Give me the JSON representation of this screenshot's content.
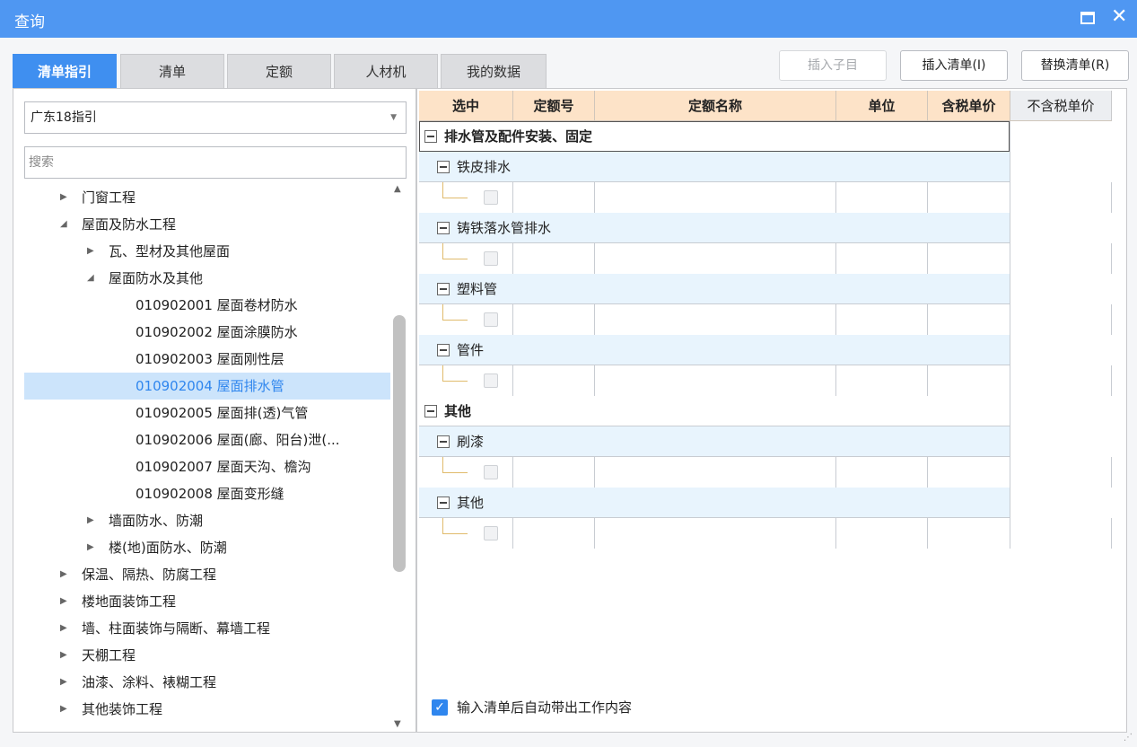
{
  "window": {
    "title": "查询",
    "maximize_icon": "square-icon",
    "close_label": "✕"
  },
  "tabs": [
    {
      "label": "清单指引",
      "active": true
    },
    {
      "label": "清单",
      "active": false
    },
    {
      "label": "定额",
      "active": false
    },
    {
      "label": "人材机",
      "active": false
    },
    {
      "label": "我的数据",
      "active": false
    }
  ],
  "toolbar": {
    "insert_child_label": "插入子目",
    "insert_list_label": "插入清单(I)",
    "replace_list_label": "替换清单(R)"
  },
  "left": {
    "selector_value": "广东18指引",
    "search_placeholder": "搜索",
    "tree": [
      {
        "label": "门窗工程",
        "expanded": false
      },
      {
        "label": "屋面及防水工程",
        "expanded": true
      },
      {
        "label": "瓦、型材及其他屋面",
        "expanded": false
      },
      {
        "label": "屋面防水及其他",
        "expanded": true
      },
      {
        "label": "010902001  屋面卷材防水"
      },
      {
        "label": "010902002  屋面涂膜防水"
      },
      {
        "label": "010902003  屋面刚性层"
      },
      {
        "label": "010902004  屋面排水管",
        "selected": true
      },
      {
        "label": "010902005  屋面排(透)气管"
      },
      {
        "label": "010902006  屋面(廊、阳台)泄(..."
      },
      {
        "label": "010902007  屋面天沟、檐沟"
      },
      {
        "label": "010902008  屋面变形缝"
      },
      {
        "label": "墙面防水、防潮",
        "expanded": false
      },
      {
        "label": "楼(地)面防水、防潮",
        "expanded": false
      },
      {
        "label": "保温、隔热、防腐工程",
        "expanded": false
      },
      {
        "label": "楼地面装饰工程",
        "expanded": false
      },
      {
        "label": "墙、柱面装饰与隔断、幕墙工程",
        "expanded": false
      },
      {
        "label": "天棚工程",
        "expanded": false
      },
      {
        "label": "油漆、涂料、裱糊工程",
        "expanded": false
      },
      {
        "label": "其他装饰工程",
        "expanded": false
      }
    ]
  },
  "grid": {
    "columns": [
      "选中",
      "定额号",
      "定额名称",
      "单位",
      "含税单价",
      "不含税单价"
    ],
    "rows": [
      {
        "type": "group",
        "label": "排水管及配件安装、固定"
      },
      {
        "type": "sub",
        "label": "铁皮排水"
      },
      {
        "type": "item"
      },
      {
        "type": "sub",
        "label": "铸铁落水管排水"
      },
      {
        "type": "item"
      },
      {
        "type": "sub",
        "label": "塑料管"
      },
      {
        "type": "item"
      },
      {
        "type": "sub",
        "label": "管件"
      },
      {
        "type": "item"
      },
      {
        "type": "group",
        "label": "其他"
      },
      {
        "type": "sub",
        "label": "刷漆"
      },
      {
        "type": "item"
      },
      {
        "type": "sub",
        "label": "其他"
      },
      {
        "type": "item"
      }
    ]
  },
  "options": {
    "auto_fill_label": "输入清单后自动带出工作内容",
    "auto_fill_checked": true
  },
  "colors": {
    "titlebar": "#4f97f2",
    "active_tab": "#3f8ff0",
    "header_bg": "#fde3c8",
    "sub_row_bg": "#e8f4fd",
    "selected_bg": "#cce4fb"
  }
}
